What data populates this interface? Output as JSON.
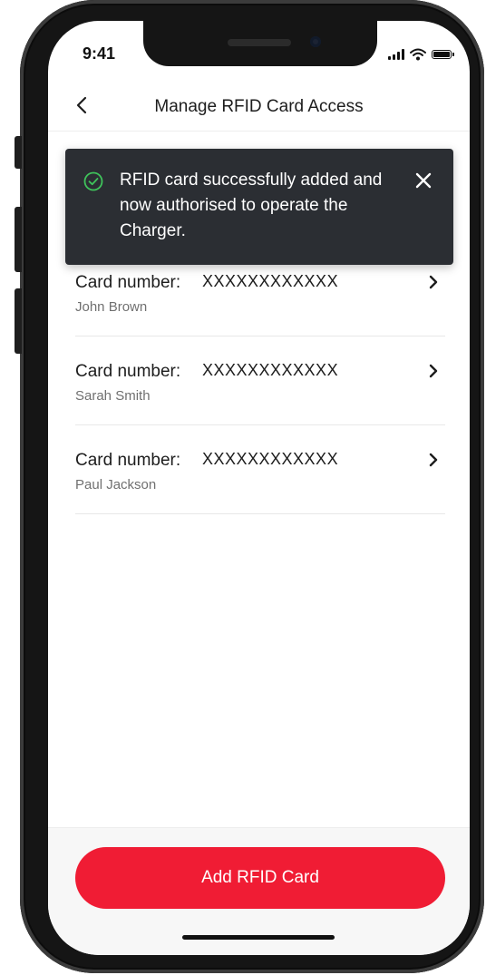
{
  "status_bar": {
    "time": "9:41"
  },
  "nav": {
    "title": "Manage RFID Card Access",
    "back_icon": "chevron-left-icon"
  },
  "toast": {
    "icon": "check-circle-icon",
    "message": "RFID card successfully added and now authorised to operate the Charger.",
    "close_icon": "close-icon",
    "background": "#2b2e33",
    "accent": "#3fc35b"
  },
  "cards": [
    {
      "label": "Card number:",
      "number": "XXXXXXXXXXXX",
      "owner": "John Brown"
    },
    {
      "label": "Card number:",
      "number": "XXXXXXXXXXXX",
      "owner": "Sarah Smith"
    },
    {
      "label": "Card number:",
      "number": "XXXXXXXXXXXX",
      "owner": "Paul Jackson"
    }
  ],
  "actions": {
    "add_label": "Add RFID Card",
    "add_color": "#f01c34"
  }
}
